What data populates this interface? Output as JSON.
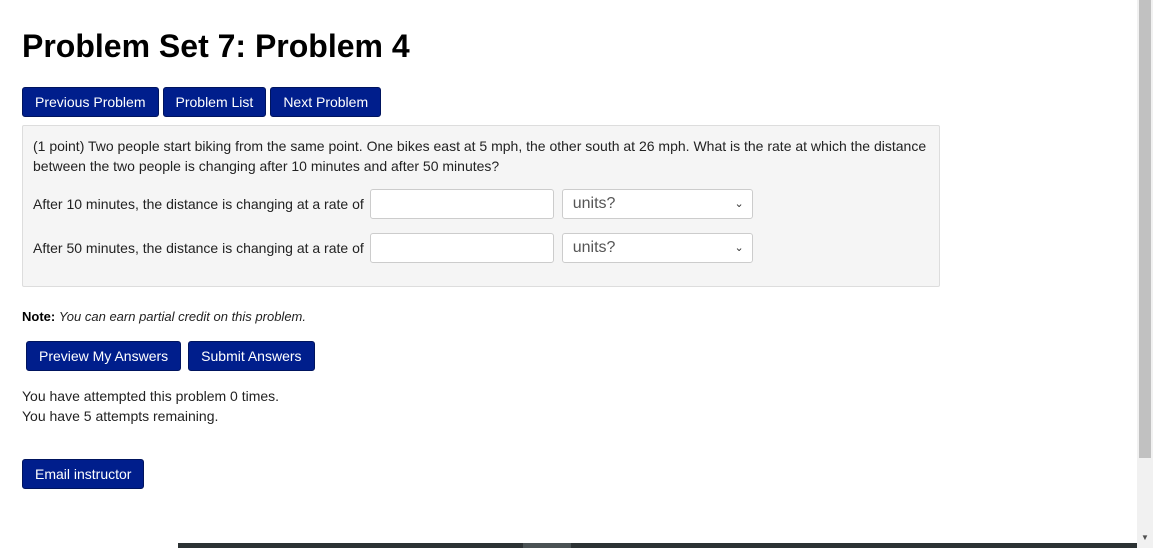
{
  "page": {
    "title": "Problem Set 7: Problem 4"
  },
  "nav": {
    "previous_label": "Previous Problem",
    "list_label": "Problem List",
    "next_label": "Next Problem"
  },
  "problem": {
    "text": "(1 point) Two people start biking from the same point. One bikes east at 5 mph, the other south at 26 mph. What is the rate at which the distance between the two people is changing after 10 minutes and after 50 minutes?",
    "answers": [
      {
        "label": "After 10 minutes, the distance is changing at a rate of",
        "value": "",
        "units_selected": "units?"
      },
      {
        "label": "After 50 minutes, the distance is changing at a rate of",
        "value": "",
        "units_selected": "units?"
      }
    ]
  },
  "note": {
    "label": "Note:",
    "text": "You can earn partial credit on this problem."
  },
  "actions": {
    "preview_label": "Preview My Answers",
    "submit_label": "Submit Answers"
  },
  "attempts": {
    "attempted": "You have attempted this problem 0 times.",
    "remaining": "You have 5 attempts remaining."
  },
  "email": {
    "label": "Email instructor"
  },
  "colors": {
    "button_bg": "#001e8c",
    "problem_bg": "#f5f5f5"
  }
}
